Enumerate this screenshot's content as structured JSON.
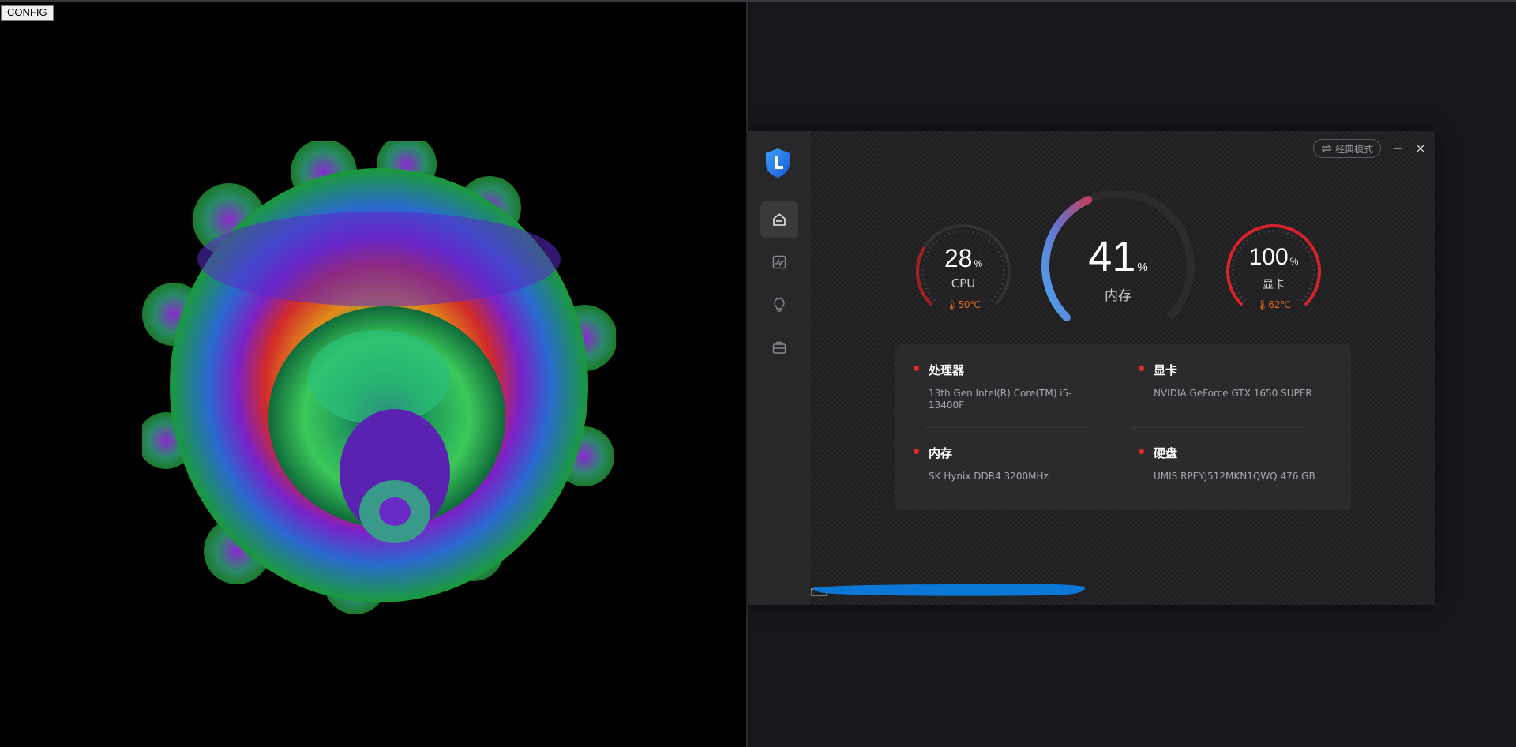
{
  "left_pane": {
    "config_button": "CONFIG"
  },
  "app": {
    "mode_button": "经典模式",
    "gauges": {
      "cpu": {
        "value": "28",
        "unit": "%",
        "label": "CPU",
        "temp": "50℃",
        "percent": 28
      },
      "memory": {
        "value": "41",
        "unit": "%",
        "label": "内存",
        "percent": 41
      },
      "gpu": {
        "value": "100",
        "unit": "%",
        "label": "显卡",
        "temp": "62℃",
        "percent": 100
      }
    },
    "info": {
      "processor": {
        "title": "处理器",
        "value": "13th Gen Intel(R) Core(TM) i5-13400F"
      },
      "graphics": {
        "title": "显卡",
        "value": "NVIDIA GeForce GTX 1650 SUPER"
      },
      "memory": {
        "title": "内存",
        "value": "SK Hynix DDR4 3200MHz"
      },
      "disk": {
        "title": "硬盘",
        "value": "UMIS RPEYJ512MKN1QWQ 476 GB"
      }
    },
    "colors": {
      "accent_red": "#e02a2a",
      "temp_orange": "#e06a1e",
      "memory_gradient_start": "#4aa8f0",
      "memory_gradient_end": "#c04060",
      "redaction_blue": "#0b78d8"
    }
  }
}
